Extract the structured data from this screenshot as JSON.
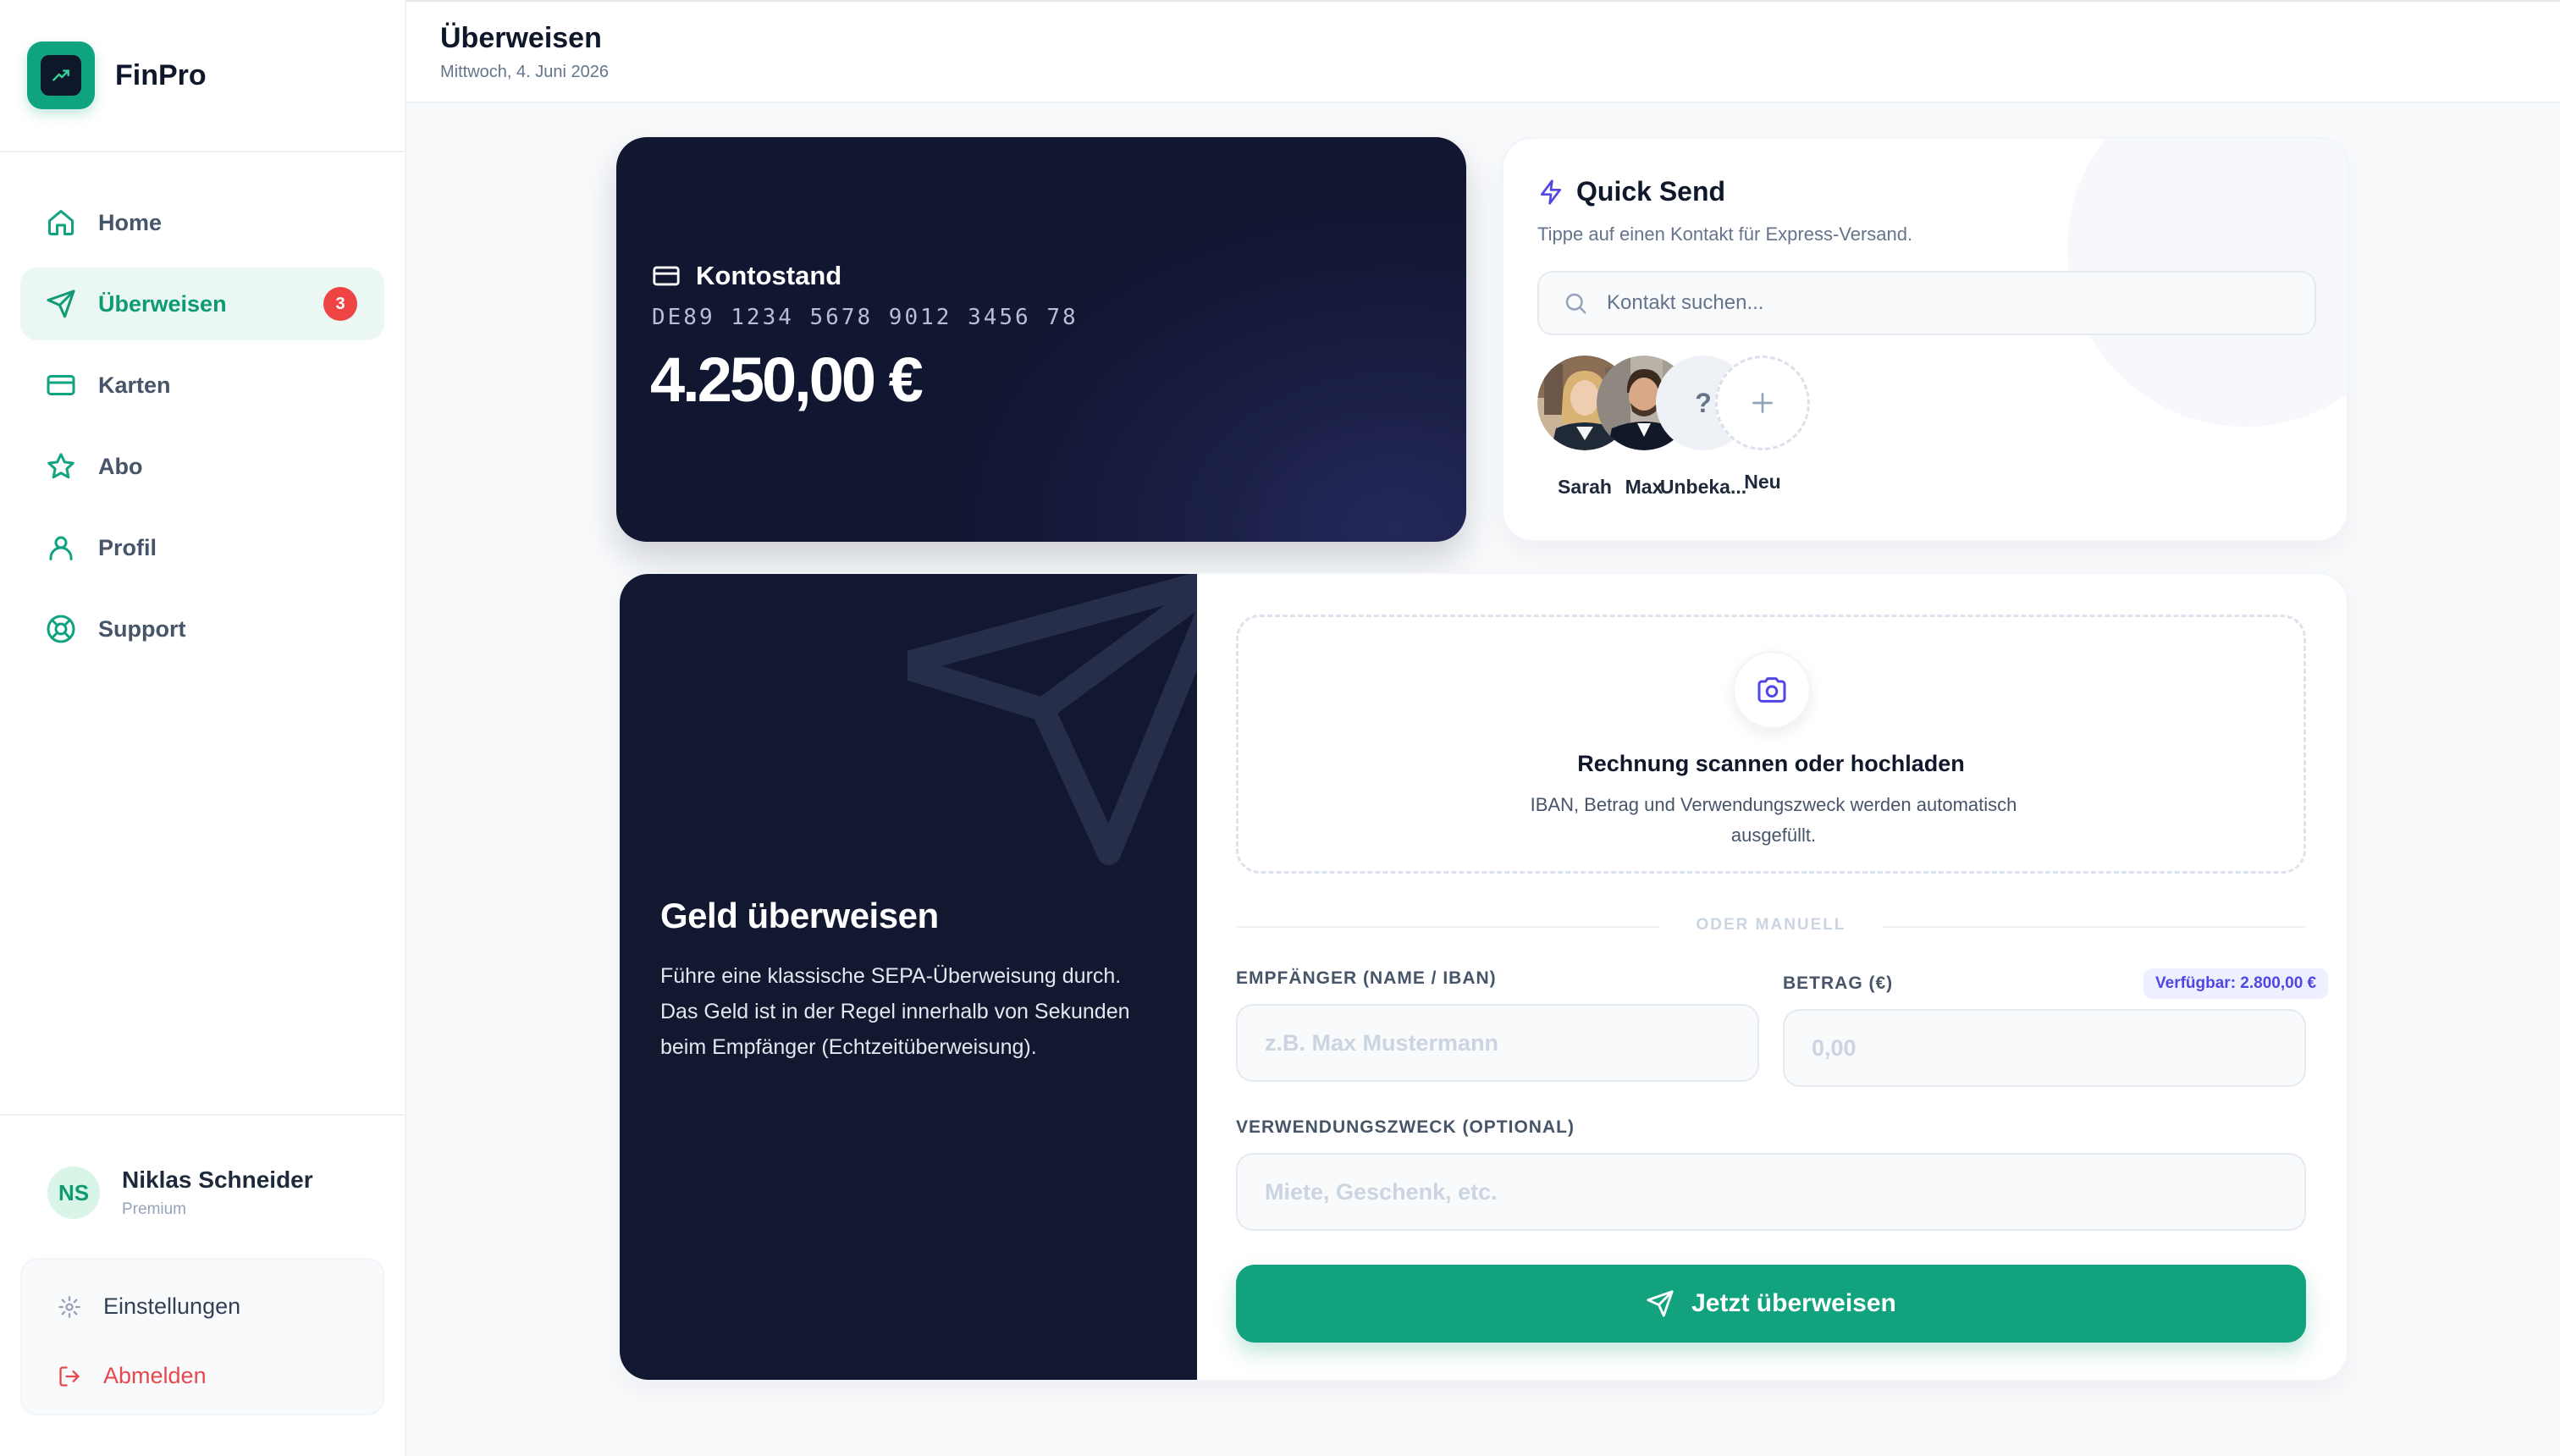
{
  "app": {
    "name": "FinPro"
  },
  "sidebar": {
    "items": [
      {
        "label": "Home",
        "icon": "home-icon",
        "active": false
      },
      {
        "label": "Überweisen",
        "icon": "send-icon",
        "active": true,
        "badge": "3"
      },
      {
        "label": "Karten",
        "icon": "credit-card-icon",
        "active": false
      },
      {
        "label": "Abo",
        "icon": "star-icon",
        "active": false
      },
      {
        "label": "Profil",
        "icon": "user-icon",
        "active": false
      },
      {
        "label": "Support",
        "icon": "life-buoy-icon",
        "active": false
      }
    ],
    "user": {
      "initials": "NS",
      "name": "Niklas Schneider",
      "tier": "Premium"
    },
    "settings_label": "Einstellungen",
    "logout_label": "Abmelden"
  },
  "header": {
    "title": "Überweisen",
    "date": "Mittwoch, 4. Juni 2026"
  },
  "balance": {
    "title": "Kontostand",
    "iban": "DE89 1234 5678 9012 3456 78",
    "amount": "4.250,00 €"
  },
  "quick_send": {
    "title": "Quick Send",
    "subtitle": "Tippe auf einen Kontakt für Express-Versand.",
    "search_placeholder": "Kontakt suchen...",
    "contacts": [
      {
        "name": "Sarah",
        "type": "photo"
      },
      {
        "name": "Max",
        "type": "photo"
      },
      {
        "name": "Unbeka...",
        "type": "unknown",
        "symbol": "?"
      },
      {
        "name": "Neu",
        "type": "add",
        "symbol": "+"
      }
    ]
  },
  "transfer": {
    "heading": "Geld überweisen",
    "description": "Führe eine klassische SEPA-Überweisung durch. Das Geld ist in der Regel innerhalb von Sekunden beim Empfänger (Echtzeitüberweisung).",
    "upload_title": "Rechnung scannen oder hochladen",
    "upload_desc": "IBAN, Betrag und Verwendungszweck werden automatisch ausgefüllt.",
    "divider": "ODER MANUELL",
    "recipient_label": "EMPFÄNGER (NAME / IBAN)",
    "recipient_placeholder": "z.B. Max Mustermann",
    "amount_label": "BETRAG (€)",
    "amount_placeholder": "0,00",
    "available": "Verfügbar: 2.800,00 €",
    "purpose_label": "VERWENDUNGSZWECK (OPTIONAL)",
    "purpose_placeholder": "Miete, Geschenk, etc.",
    "submit_label": "Jetzt überweisen"
  },
  "colors": {
    "accent": "#12a27d",
    "dark_card": "#111631",
    "badge_red": "#ef4444",
    "available_badge": "#4f46e5"
  }
}
